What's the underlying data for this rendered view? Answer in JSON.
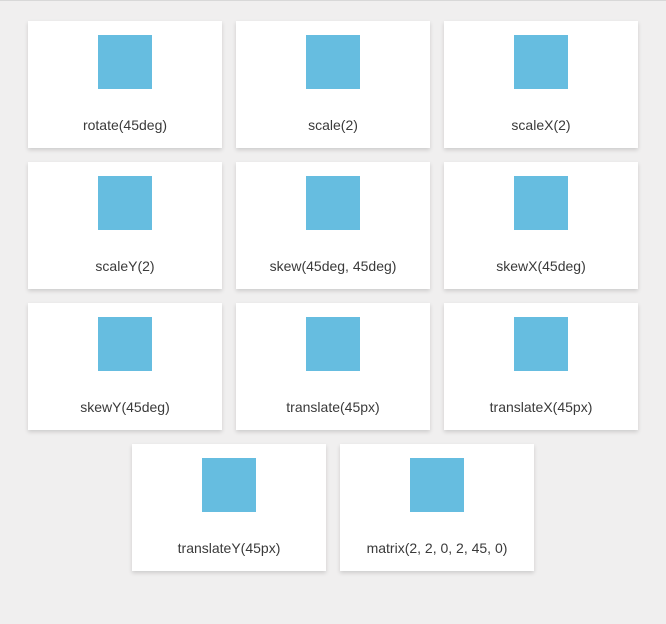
{
  "swatch_color": "#66bde0",
  "cards": [
    {
      "label": "rotate(45deg)"
    },
    {
      "label": "scale(2)"
    },
    {
      "label": "scaleX(2)"
    },
    {
      "label": "scaleY(2)"
    },
    {
      "label": "skew(45deg, 45deg)"
    },
    {
      "label": "skewX(45deg)"
    },
    {
      "label": "skewY(45deg)"
    },
    {
      "label": "translate(45px)"
    },
    {
      "label": "translateX(45px)"
    },
    {
      "label": "translateY(45px)"
    },
    {
      "label": "matrix(2, 2, 0, 2, 45, 0)"
    }
  ]
}
